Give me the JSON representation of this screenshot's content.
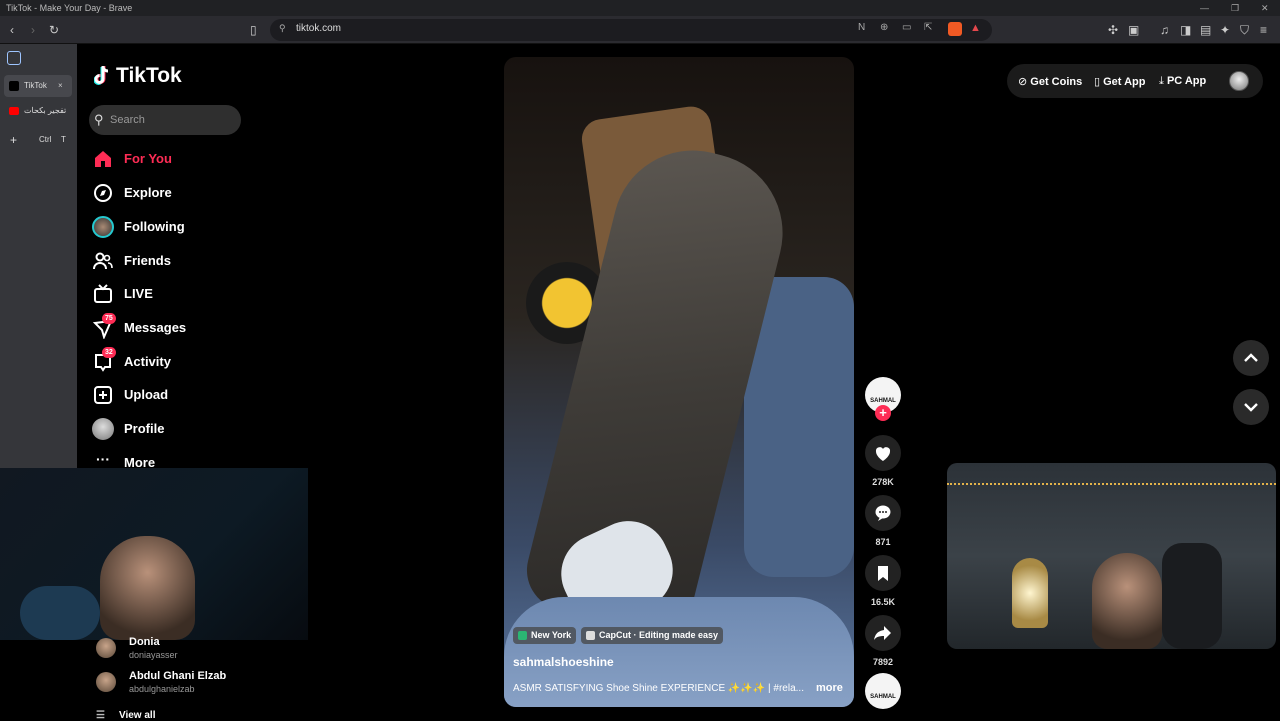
{
  "browser": {
    "window_title": "TikTok - Make Your Day - Brave",
    "url": "tiktok.com"
  },
  "vertical_tabs": {
    "tabs": [
      {
        "label": "TikTok",
        "close": "×"
      },
      {
        "label": "تفجير بكحات"
      }
    ],
    "new_tab_shortcut_ctrl": "Ctrl",
    "new_tab_shortcut_key": "T"
  },
  "sidebar": {
    "logo": "TikTok",
    "search_placeholder": "Search",
    "nav": [
      {
        "label": "For You",
        "icon": "home-icon",
        "active": true
      },
      {
        "label": "Explore",
        "icon": "compass-icon"
      },
      {
        "label": "Following",
        "icon": "following-avatar-icon"
      },
      {
        "label": "Friends",
        "icon": "friends-icon"
      },
      {
        "label": "LIVE",
        "icon": "live-tv-icon"
      },
      {
        "label": "Messages",
        "icon": "messages-icon",
        "badge": "75"
      },
      {
        "label": "Activity",
        "icon": "activity-icon",
        "badge": "32"
      },
      {
        "label": "Upload",
        "icon": "upload-icon"
      },
      {
        "label": "Profile",
        "icon": "profile-avatar-icon"
      },
      {
        "label": "More",
        "icon": "more-dots-icon"
      }
    ],
    "following_accounts": [
      {
        "name": "Donia",
        "username": "doniayasser"
      },
      {
        "name": "Abdul Ghani Elzab",
        "username": "abdulghanielzab"
      }
    ],
    "view_all": "View all"
  },
  "video": {
    "location_chip": "New York",
    "capcut_chip": "CapCut · Editing made easy",
    "author": "sahmalshoeshine",
    "description": "ASMR SATISFYING Shoe Shine EXPERIENCE ✨✨✨ | #rela...",
    "more": "more",
    "creator_badge": "SAHMAL",
    "stats": {
      "likes": "278K",
      "comments": "871",
      "saves": "16.5K",
      "shares": "7892"
    }
  },
  "header_links": {
    "get_coins": "Get Coins",
    "get_app": "Get App",
    "pc_app": "PC App"
  },
  "colors": {
    "accent": "#fe2c55",
    "background": "#000000",
    "sidebar_browser": "#35363a"
  }
}
